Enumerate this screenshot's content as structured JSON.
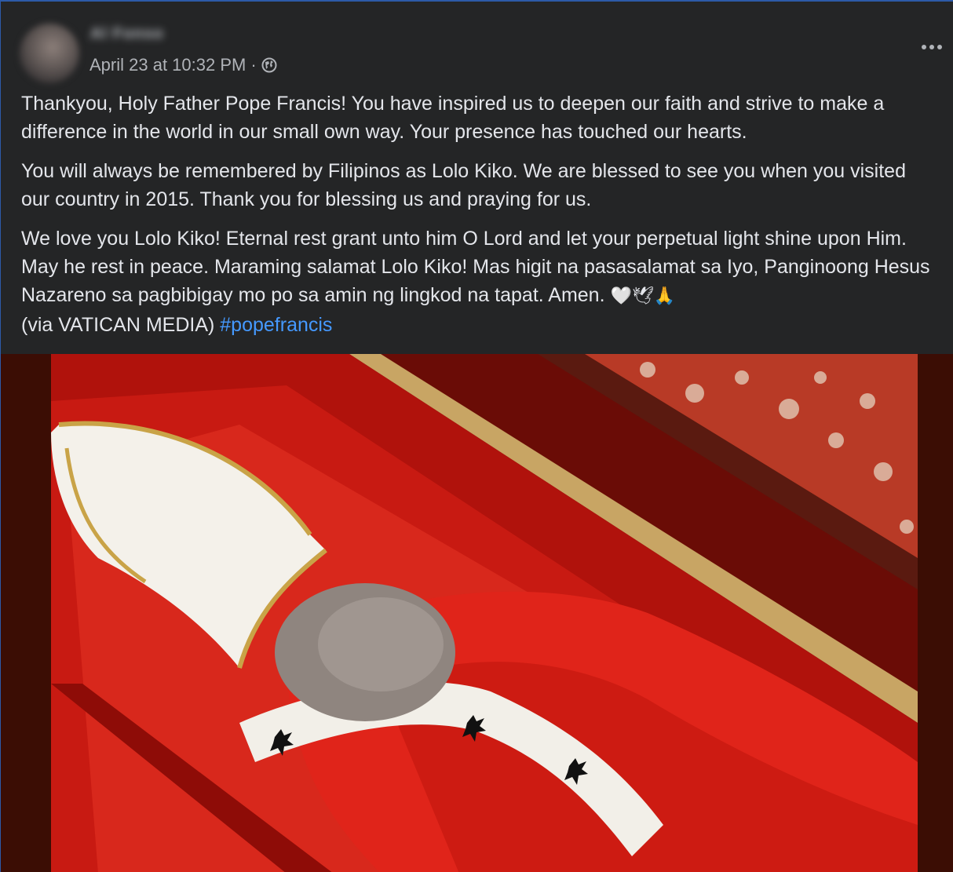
{
  "post": {
    "author": "Al Fonso",
    "timestamp": "April 23 at 10:32 PM",
    "separator": "·",
    "privacy_icon": "globe-icon",
    "more_icon": "more-horizontal-icon",
    "paragraphs": [
      "Thankyou, Holy Father Pope Francis! You have inspired us to deepen our faith and strive to make a difference in the world in our small own way. Your presence has touched our hearts.",
      "You will always be remembered by Filipinos as Lolo Kiko. We are blessed to see you when you visited our country in 2015. Thank you for blessing us and praying for us.",
      "We love you Lolo Kiko! Eternal rest grant unto him O Lord and let your perpetual light shine upon Him. May he rest in peace. Maraming salamat Lolo Kiko! Mas higit na pasasalamat sa Iyo, Panginoong Hesus Nazareno sa pagbibigay mo po sa amin ng lingkod na tapat. Amen."
    ],
    "emojis": "🤍🕊🙏",
    "credit": "(via VATICAN MEDIA)",
    "hashtag": "#popefrancis"
  },
  "colors": {
    "background": "#242526",
    "text": "#e4e6eb",
    "secondary_text": "#b0b3b8",
    "link": "#4599ff",
    "media_background": "#3b0d04"
  }
}
